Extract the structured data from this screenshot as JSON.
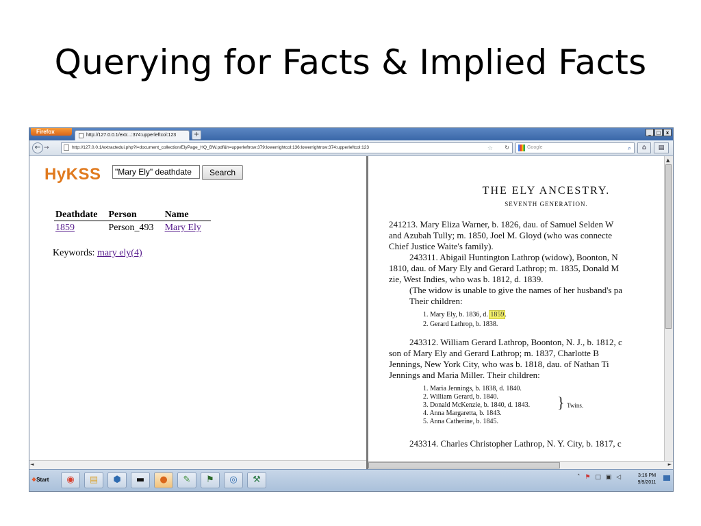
{
  "slide": {
    "title": "Querying for Facts & Implied Facts"
  },
  "browser": {
    "menu_label": "Firefox",
    "tab_label": "http://127.0.0.1/extr...:374:upperleftcol:123",
    "new_tab": "+",
    "window_controls": [
      "_",
      "□",
      "x"
    ],
    "url": "http://127.0.0.1/extractedui.php?l=document_collection/ElyPage_HQ_BW.pdf&h=upperleftrow:379:lowerrightcol:136:lowerrightrow:374:upperleftcol:123",
    "search_placeholder": "Google",
    "icons": {
      "back": "back-arrow-icon",
      "forward": "forward-arrow-icon",
      "bookmark": "star-icon",
      "reload": "reload-icon",
      "search": "magnifier-icon",
      "home": "home-icon",
      "menu": "menu-icon"
    }
  },
  "hykss": {
    "logo": "HyKSS",
    "query_value": "\"Mary Ely\" deathdate",
    "search_button": "Search",
    "table": {
      "headers": [
        "Deathdate",
        "Person",
        "Name"
      ],
      "rows": [
        {
          "deathdate": "1859",
          "person": "Person_493",
          "name": "Mary Ely"
        }
      ]
    },
    "keywords_label": "Keywords:",
    "keywords_link": "mary ely(4)"
  },
  "document": {
    "title": "THE ELY ANCESTRY.",
    "subtitle": "SEVENTH GENERATION.",
    "lines": [
      "241213. Mary Eliza Warner, b. 1826, dau. of Samuel Selden W",
      "and Azubah Tully; m. 1850, Joel M. Gloyd (who was connecte",
      "Chief Justice Waite's family).",
      "243311. Abigail Huntington Lathrop (widow), Boonton, N",
      "1810, dau. of Mary Ely and Gerard Lathrop; m. 1835, Donald M",
      "zie, West Indies, who was b. 1812, d. 1839.",
      "(The widow is unable to give the names of her husband's pa",
      "Their children:"
    ],
    "children_1_prefix": "1. Mary Ely, b. 1836, d. ",
    "children_1_highlight": "1859",
    "children_1_suffix": ".",
    "children_2": "2. Gerard Lathrop, b. 1838.",
    "lines2": [
      "243312. William Gerard Lathrop, Boonton, N. J., b. 1812, c",
      "son of Mary Ely and Gerard Lathrop; m. 1837, Charlotte B",
      "Jennings, New York City, who was b. 1818, dau. of Nathan Ti",
      "Jennings and Maria Miller.  Their children:"
    ],
    "children2": [
      "1. Maria Jennings, b. 1838, d. 1840.",
      "2. William Gerard, b. 1840.",
      "3. Donald McKenzie, b. 1840, d. 1843.",
      "4. Anna Margaretta, b. 1843.",
      "5. Anna Catherine, b. 1845."
    ],
    "twins_label": "Twins.",
    "last_line": "243314. Charles Christopher Lathrop, N. Y. City, b. 1817, c"
  },
  "taskbar": {
    "start_label": "Start",
    "apps": [
      "chrome-icon",
      "folder-icon",
      "virtualbox-icon",
      "terminal-icon",
      "firefox-icon",
      "editor-icon",
      "image-icon",
      "network-icon",
      "tool-icon"
    ],
    "time": "3:16 PM",
    "date": "9/9/2011"
  }
}
